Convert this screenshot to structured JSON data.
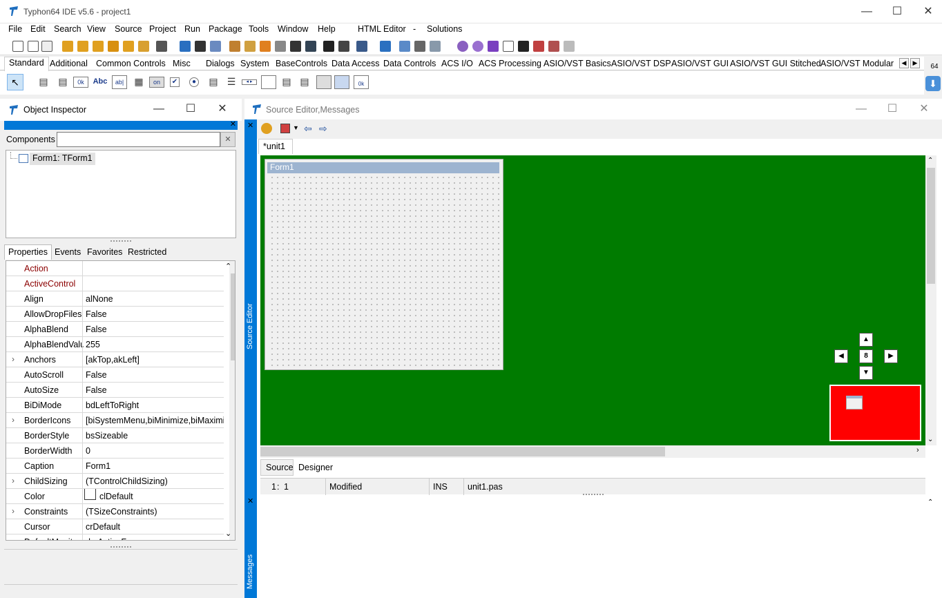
{
  "window": {
    "title": "Typhon64 IDE v5.6 - project1"
  },
  "menu": [
    "File",
    "Edit",
    "Search",
    "View",
    "Source",
    "Project",
    "Run",
    "Package",
    "Tools",
    "Window",
    "Help",
    "HTML Editor",
    "-",
    "Solutions"
  ],
  "palette_tabs": [
    "Standard",
    "Additional",
    "Common Controls",
    "Misc",
    "Dialogs",
    "System",
    "BaseControls",
    "Data Access",
    "Data Controls",
    "ACS I/O",
    "ACS Processing",
    "ASIO/VST Basics",
    "ASIO/VST DSP",
    "ASIO/VST GUI",
    "ASIO/VST GUI Stitched",
    "ASIO/VST Modular"
  ],
  "palette_badge": "64",
  "palette_icon_text": {
    "button": "0k",
    "label": "Abc",
    "edit": "ab|",
    "toggle": "on",
    "bitbtn": "0k"
  },
  "object_inspector": {
    "title": "Object Inspector",
    "components_label": "Components",
    "tree_node": "Form1: TForm1",
    "tabs": [
      "Properties",
      "Events",
      "Favorites",
      "Restricted"
    ],
    "properties": [
      {
        "name": "Action",
        "value": "",
        "style": "red"
      },
      {
        "name": "ActiveControl",
        "value": "",
        "style": "red"
      },
      {
        "name": "Align",
        "value": "alNone"
      },
      {
        "name": "AllowDropFiles",
        "value": "False"
      },
      {
        "name": "AlphaBlend",
        "value": "False"
      },
      {
        "name": "AlphaBlendValu",
        "value": "255"
      },
      {
        "name": "Anchors",
        "value": "[akTop,akLeft]",
        "expandable": true
      },
      {
        "name": "AutoScroll",
        "value": "False"
      },
      {
        "name": "AutoSize",
        "value": "False"
      },
      {
        "name": "BiDiMode",
        "value": "bdLeftToRight"
      },
      {
        "name": "BorderIcons",
        "value": "[biSystemMenu,biMinimize,biMaximi:",
        "expandable": true
      },
      {
        "name": "BorderStyle",
        "value": "bsSizeable"
      },
      {
        "name": "BorderWidth",
        "value": "0"
      },
      {
        "name": "Caption",
        "value": "Form1"
      },
      {
        "name": "ChildSizing",
        "value": "(TControlChildSizing)",
        "expandable": true
      },
      {
        "name": "Color",
        "value": "clDefault",
        "swatch": "#ffffff"
      },
      {
        "name": "Constraints",
        "value": "(TSizeConstraints)",
        "expandable": true
      },
      {
        "name": "Cursor",
        "value": "crDefault"
      },
      {
        "name": "DefaultMonit",
        "value": "dmActiveF"
      }
    ]
  },
  "source_editor": {
    "title": "Source Editor,Messages",
    "side_label": "Source Editor",
    "tab": "*unit1",
    "form_caption": "Form1",
    "bottom_tabs": [
      "Source",
      "Designer"
    ],
    "status": {
      "line": "1",
      "col": "1",
      "state": "Modified",
      "mode": "INS",
      "file": "unit1.pas"
    },
    "nav_center": "8",
    "messages_label": "Messages"
  },
  "colors": {
    "accent": "#0078d7",
    "designer_bg": "#007b00",
    "minimap": "#ff0000"
  }
}
